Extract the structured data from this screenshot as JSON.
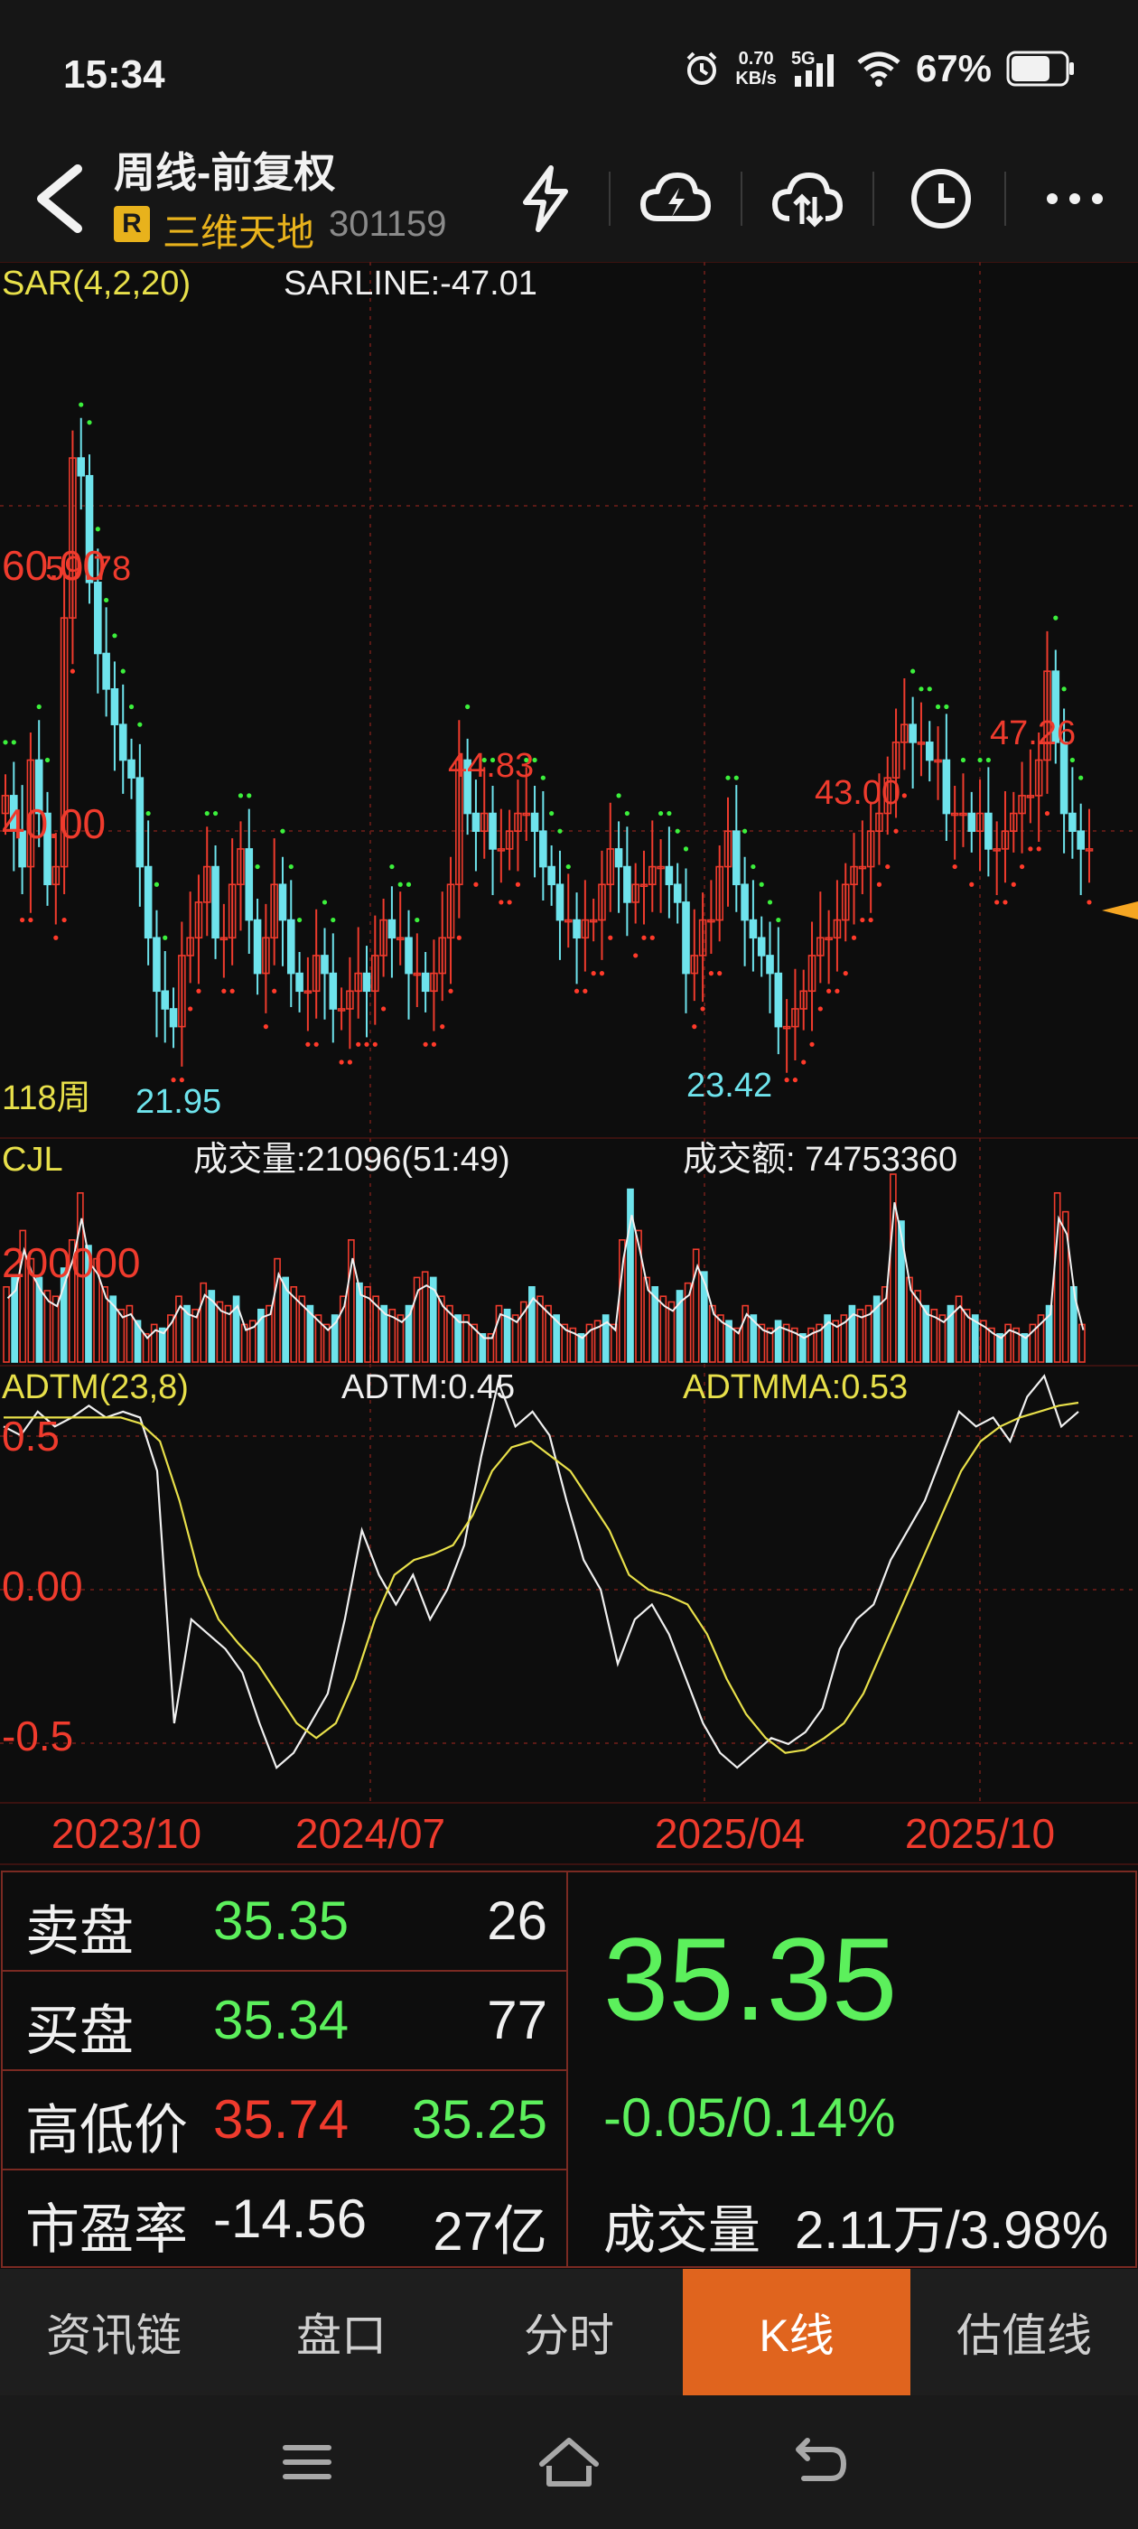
{
  "status_bar": {
    "time": "15:34",
    "net_speed_value": "0.70",
    "net_speed_unit": "KB/s",
    "network": "5G",
    "battery": "67%"
  },
  "header": {
    "title": "周线-前复权",
    "badge": "R",
    "stock_name": "三维天地",
    "stock_code": "301159",
    "icons": [
      "lightning-icon",
      "cloud-lightning-icon",
      "cloud-sync-icon",
      "clock-icon",
      "more-icon"
    ]
  },
  "main_chart": {
    "indicator_label": "SAR(4,2,20)",
    "sarline_label": "SARLINE:-47.01",
    "y_tick_labels": [
      "60.00",
      "40.00"
    ],
    "period_label": "118周",
    "marks": {
      "high": "59.78",
      "low_left": "21.95",
      "high_mid": "44.83",
      "low_mid": "23.42",
      "high_right1": "43.00",
      "high_right2": "47.26"
    }
  },
  "volume_chart": {
    "label": "CJL",
    "volume_text": "成交量:21096(51:49)",
    "amount_text": "成交额: 74753360",
    "y_tick_label": "200000"
  },
  "adtm_chart": {
    "label": "ADTM(23,8)",
    "adtm_text": "ADTM:0.45",
    "adtmma_text": "ADTMMA:0.53",
    "y_tick_labels": [
      "0.5",
      "0.00",
      "-0.5"
    ]
  },
  "x_axis": {
    "labels": [
      "2023/10",
      "2024/07",
      "2025/04",
      "2025/10"
    ]
  },
  "quote": {
    "sell": {
      "label": "卖盘",
      "price": "35.35",
      "volume": "26"
    },
    "buy": {
      "label": "买盘",
      "price": "35.34",
      "volume": "77"
    },
    "high_low": {
      "label": "高低价",
      "high": "35.74",
      "low": "35.25"
    },
    "pe": {
      "label": "市盈率",
      "value": "-14.56",
      "market_cap": "27亿"
    },
    "last_price": "35.35",
    "change": "-0.05/0.14%",
    "volume_label": "成交量",
    "volume_value": "2.11万/3.98%"
  },
  "tabs": [
    {
      "label": "资讯链"
    },
    {
      "label": "盘口"
    },
    {
      "label": "分时"
    },
    {
      "label": "K线",
      "active": true
    },
    {
      "label": "估值线"
    }
  ],
  "colors": {
    "up": "#ef3b2d",
    "down": "#6ee3ec",
    "sar_up": "#ff3a2a",
    "sar_down": "#3cf03c",
    "accent_tab": "#e0641e",
    "price_green": "#5cf05c"
  },
  "chart_data": [
    {
      "type": "candlestick",
      "title": "SAR(4,2,20)",
      "annotations": [
        {
          "label": "59.78",
          "kind": "high"
        },
        {
          "label": "21.95",
          "kind": "low"
        },
        {
          "label": "44.83",
          "kind": "high"
        },
        {
          "label": "23.42",
          "kind": "low"
        },
        {
          "label": "43.00",
          "kind": "high"
        },
        {
          "label": "47.26",
          "kind": "high"
        }
      ],
      "ylim": [
        20,
        66
      ],
      "close_series": [
        38,
        36,
        34,
        40,
        37,
        33,
        34,
        48,
        57,
        56,
        50,
        46,
        44,
        42,
        40,
        39,
        34,
        30,
        27,
        26,
        25,
        29,
        30,
        32,
        34,
        30,
        30,
        33,
        35,
        31,
        28,
        30,
        33,
        31,
        28,
        27,
        27,
        29,
        28,
        26,
        26,
        27,
        28,
        27,
        29,
        31,
        30,
        30,
        28,
        28,
        27,
        28,
        30,
        33,
        40,
        37,
        36,
        37,
        35,
        35,
        36,
        37,
        37,
        36,
        34,
        33,
        31,
        31,
        30,
        31,
        31,
        33,
        35,
        34,
        32,
        33,
        33,
        34,
        34,
        33,
        32,
        28,
        29,
        31,
        31,
        34,
        36,
        33,
        31,
        30,
        29,
        28,
        25,
        25,
        26,
        27,
        29,
        30,
        30,
        31,
        33,
        34,
        34,
        36,
        37,
        39,
        41,
        42,
        41,
        41,
        40,
        40,
        37,
        37,
        37,
        36,
        37,
        35,
        35,
        36,
        37,
        38,
        38,
        40,
        45,
        41,
        37,
        36,
        35,
        35
      ]
    },
    {
      "type": "bar",
      "title": "CJL",
      "ylim": [
        0,
        480000
      ],
      "values_relative": [
        0.4,
        0.45,
        0.7,
        0.55,
        0.45,
        0.38,
        0.35,
        0.5,
        0.65,
        0.9,
        0.62,
        0.55,
        0.4,
        0.35,
        0.28,
        0.3,
        0.22,
        0.15,
        0.2,
        0.18,
        0.25,
        0.35,
        0.3,
        0.28,
        0.42,
        0.38,
        0.32,
        0.3,
        0.35,
        0.2,
        0.22,
        0.28,
        0.3,
        0.55,
        0.45,
        0.4,
        0.35,
        0.3,
        0.25,
        0.2,
        0.25,
        0.35,
        0.65,
        0.42,
        0.4,
        0.35,
        0.3,
        0.28,
        0.25,
        0.3,
        0.45,
        0.48,
        0.45,
        0.35,
        0.3,
        0.25,
        0.25,
        0.2,
        0.15,
        0.15,
        0.3,
        0.28,
        0.25,
        0.32,
        0.4,
        0.35,
        0.3,
        0.25,
        0.2,
        0.18,
        0.15,
        0.2,
        0.22,
        0.25,
        0.2,
        0.65,
        0.92,
        0.7,
        0.45,
        0.4,
        0.35,
        0.32,
        0.38,
        0.42,
        0.6,
        0.48,
        0.3,
        0.25,
        0.22,
        0.18,
        0.3,
        0.25,
        0.2,
        0.18,
        0.22,
        0.2,
        0.18,
        0.15,
        0.18,
        0.2,
        0.25,
        0.22,
        0.25,
        0.3,
        0.28,
        0.3,
        0.35,
        0.4,
        1.0,
        0.75,
        0.45,
        0.38,
        0.3,
        0.28,
        0.25,
        0.3,
        0.35,
        0.28,
        0.25,
        0.22,
        0.18,
        0.15,
        0.2,
        0.18,
        0.15,
        0.2,
        0.25,
        0.3,
        0.9,
        0.8,
        0.4,
        0.2
      ]
    },
    {
      "type": "line",
      "title": "ADTM(23,8)",
      "ylim": [
        -0.8,
        0.6
      ],
      "series": [
        {
          "name": "ADTM",
          "values": [
            0.45,
            0.42,
            0.5,
            0.45,
            0.48,
            0.52,
            0.48,
            0.5,
            0.48,
            0.3,
            -0.55,
            -0.2,
            -0.25,
            -0.3,
            -0.38,
            -0.55,
            -0.7,
            -0.65,
            -0.55,
            -0.45,
            -0.2,
            0.1,
            -0.05,
            -0.15,
            -0.05,
            -0.2,
            -0.1,
            0.05,
            0.35,
            0.6,
            0.45,
            0.5,
            0.42,
            0.2,
            0.0,
            -0.1,
            -0.35,
            -0.2,
            -0.15,
            -0.25,
            -0.4,
            -0.55,
            -0.65,
            -0.7,
            -0.65,
            -0.6,
            -0.62,
            -0.58,
            -0.5,
            -0.3,
            -0.2,
            -0.15,
            0.0,
            0.1,
            0.2,
            0.35,
            0.5,
            0.45,
            0.48,
            0.4,
            0.55,
            0.62,
            0.45,
            0.5
          ]
        },
        {
          "name": "ADTMMA",
          "values": [
            0.48,
            0.48,
            0.48,
            0.48,
            0.48,
            0.48,
            0.48,
            0.46,
            0.4,
            0.2,
            -0.05,
            -0.2,
            -0.28,
            -0.35,
            -0.45,
            -0.55,
            -0.6,
            -0.55,
            -0.4,
            -0.2,
            -0.05,
            0.0,
            0.02,
            0.05,
            0.15,
            0.3,
            0.38,
            0.4,
            0.35,
            0.3,
            0.2,
            0.1,
            -0.05,
            -0.1,
            -0.12,
            -0.15,
            -0.25,
            -0.4,
            -0.52,
            -0.6,
            -0.65,
            -0.64,
            -0.6,
            -0.55,
            -0.45,
            -0.3,
            -0.15,
            0.0,
            0.15,
            0.3,
            0.4,
            0.45,
            0.48,
            0.5,
            0.52,
            0.53
          ]
        }
      ]
    }
  ]
}
